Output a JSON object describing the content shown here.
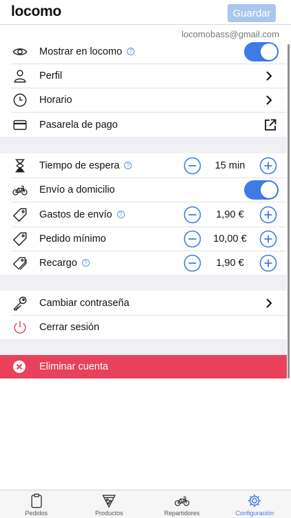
{
  "header": {
    "logo": "locomo",
    "save_label": "Guardar"
  },
  "account": {
    "email": "locomobass@gmail.com"
  },
  "section1": [
    {
      "label": "Mostrar en locomo",
      "icon": "eye-icon",
      "help": true,
      "control": "toggle",
      "on": true
    },
    {
      "label": "Perfil",
      "icon": "user-icon",
      "control": "chevron"
    },
    {
      "label": "Horario",
      "icon": "clock-icon",
      "control": "chevron"
    },
    {
      "label": "Pasarela de pago",
      "icon": "card-icon",
      "control": "external"
    }
  ],
  "section2": [
    {
      "label": "Tiempo de espera",
      "icon": "hourglass-icon",
      "help": true,
      "control": "stepper",
      "value": "15 min"
    },
    {
      "label": "Envío a domicilio",
      "icon": "bike-icon",
      "control": "toggle",
      "on": true
    },
    {
      "label": "Gastos de envío",
      "icon": "tag-icon",
      "help": true,
      "control": "stepper",
      "value": "1,90 €"
    },
    {
      "label": "Pedido mínimo",
      "icon": "tag-icon",
      "control": "stepper",
      "value": "10,00 €"
    },
    {
      "label": "Recargo",
      "icon": "tags-icon",
      "help": true,
      "control": "stepper",
      "value": "1,90 €"
    }
  ],
  "section3": [
    {
      "label": "Cambiar contraseña",
      "icon": "key-icon",
      "control": "chevron"
    },
    {
      "label": "Cerrar sesión",
      "icon": "power-icon"
    }
  ],
  "danger": {
    "label": "Eliminar cuenta",
    "icon": "close-circle-icon"
  },
  "tabs": [
    {
      "label": "Pedidos",
      "icon": "clipboard-icon",
      "active": false
    },
    {
      "label": "Productos",
      "icon": "pizza-icon",
      "active": false
    },
    {
      "label": "Repartidores",
      "icon": "bike-icon",
      "active": false
    },
    {
      "label": "Configuración",
      "icon": "gear-icon",
      "active": true
    }
  ],
  "colors": {
    "accent": "#3d7be6",
    "danger": "#e8415b",
    "save_button": "#a9c6ef",
    "power_icon": "#e0455a",
    "section_gap": "#efeff4"
  }
}
